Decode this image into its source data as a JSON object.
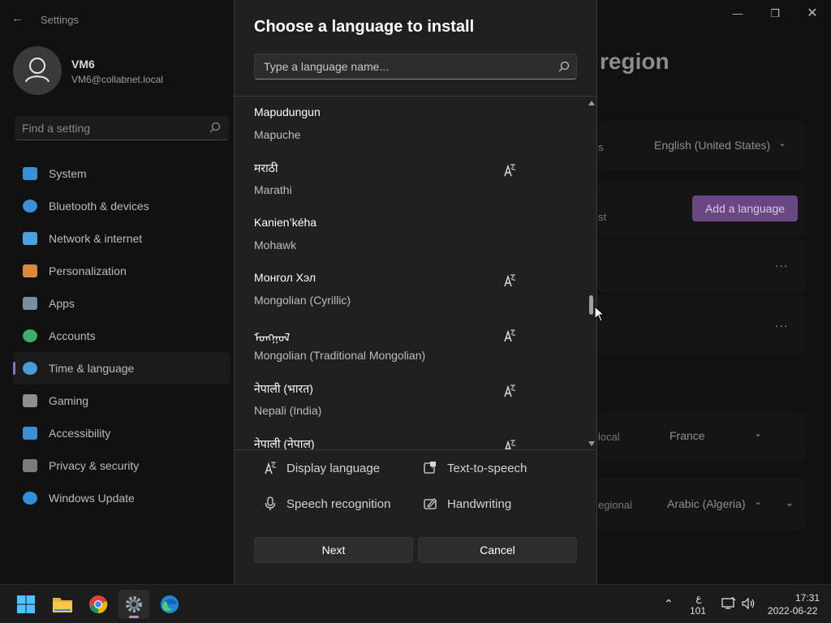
{
  "settings": {
    "app_title": "Settings",
    "user": {
      "name": "VM6",
      "email": "VM6@collabnet.local"
    },
    "find_placeholder": "Find a setting",
    "nav": [
      {
        "label": "System",
        "icon": "display-icon",
        "color": "#3a8fd6"
      },
      {
        "label": "Bluetooth & devices",
        "icon": "bluetooth-icon",
        "color": "#3a8fd6"
      },
      {
        "label": "Network & internet",
        "icon": "wifi-icon",
        "color": "#4aa3e0"
      },
      {
        "label": "Personalization",
        "icon": "brush-icon",
        "color": "#d9893b"
      },
      {
        "label": "Apps",
        "icon": "apps-icon",
        "color": "#7b8ea1"
      },
      {
        "label": "Accounts",
        "icon": "person-icon",
        "color": "#3cae6b"
      },
      {
        "label": "Time & language",
        "icon": "globe-clock-icon",
        "color": "#4a9bd8"
      },
      {
        "label": "Gaming",
        "icon": "controller-icon",
        "color": "#8f8f8f"
      },
      {
        "label": "Accessibility",
        "icon": "accessibility-icon",
        "color": "#3a8fd6"
      },
      {
        "label": "Privacy & security",
        "icon": "shield-icon",
        "color": "#7b7b7b"
      },
      {
        "label": "Windows Update",
        "icon": "update-icon",
        "color": "#2f8fd8"
      }
    ],
    "active_nav_index": 6,
    "page_heading": "region",
    "windows_display_language": "English (United States)",
    "add_language_label": "Add a language",
    "country_value": "France",
    "regional_format_value": "Arabic (Algeria)",
    "fragment_s": "s",
    "fragment_st": "st",
    "fragment_local": "local",
    "fragment_regional": "egional",
    "more_label": "...",
    "accent_color": "#9a68b8"
  },
  "dialog": {
    "title": "Choose a language to install",
    "search_placeholder": "Type a language name...",
    "languages": [
      {
        "native": "Mapudungun",
        "english": "Mapuche",
        "display_language": false
      },
      {
        "native": "मराठी",
        "english": "Marathi",
        "display_language": true
      },
      {
        "native": "Kanien’kéha",
        "english": "Mohawk",
        "display_language": false
      },
      {
        "native": "Монгол Хэл",
        "english": "Mongolian (Cyrillic)",
        "display_language": true
      },
      {
        "native": "ᠮᠣᠩᠭᠣᠯ",
        "english": "Mongolian (Traditional Mongolian)",
        "display_language": true
      },
      {
        "native": "नेपाली (भारत)",
        "english": "Nepali (India)",
        "display_language": true
      },
      {
        "native": "नेपाली (नेपाल)",
        "english": "",
        "display_language": true
      }
    ],
    "scroll_position_fraction": 0.6,
    "legend": {
      "display_language": "Display language",
      "text_to_speech": "Text-to-speech",
      "speech_recognition": "Speech recognition",
      "handwriting": "Handwriting"
    },
    "next_label": "Next",
    "cancel_label": "Cancel"
  },
  "taskbar": {
    "apps": [
      "start-icon",
      "file-explorer-icon",
      "chrome-icon",
      "settings-icon",
      "edge-icon"
    ],
    "active_app": "settings-icon",
    "tray": {
      "keyboard_lang": "ع",
      "keyboard_layout": "101",
      "time": "17:31",
      "date": "2022-06-22"
    }
  },
  "colors": {
    "background": "#111111",
    "dialog_bg": "#202020",
    "taskbar_bg": "#1c1c1c"
  }
}
